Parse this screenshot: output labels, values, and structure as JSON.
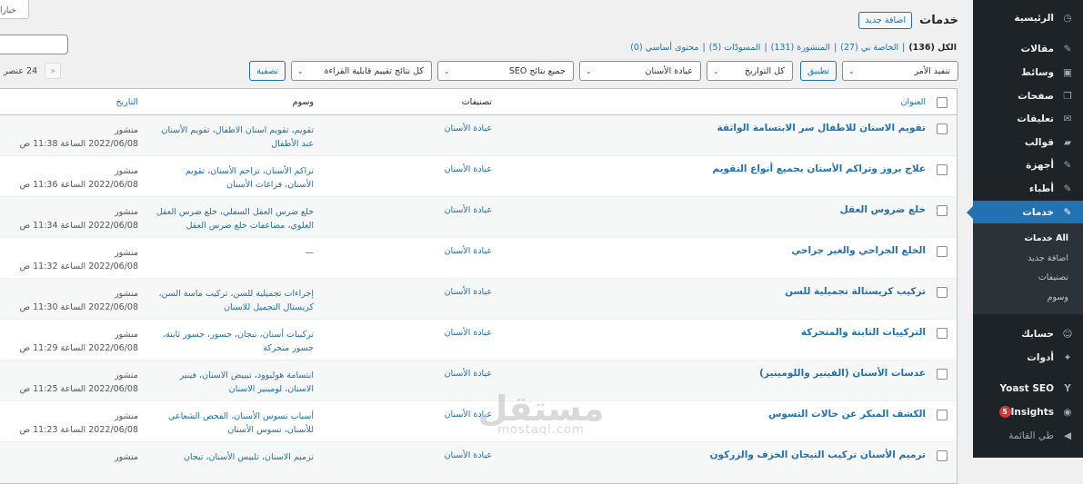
{
  "sidebar": {
    "items": [
      {
        "label": "الرئيسية",
        "icon": "dashboard-icon",
        "glyph": "◷"
      },
      {
        "label": "مقالات",
        "icon": "pin-icon",
        "glyph": "✎"
      },
      {
        "label": "وسائط",
        "icon": "media-icon",
        "glyph": "▣"
      },
      {
        "label": "صفحات",
        "icon": "pages-icon",
        "glyph": "❐"
      },
      {
        "label": "تعليقات",
        "icon": "comments-icon",
        "glyph": "✉"
      },
      {
        "label": "قوالب",
        "icon": "folder-icon",
        "glyph": "▰"
      },
      {
        "label": "أجهزة",
        "icon": "pin-icon",
        "glyph": "✎"
      },
      {
        "label": "أطباء",
        "icon": "pin-icon",
        "glyph": "✎"
      },
      {
        "label": "خدمات",
        "icon": "pin-icon",
        "glyph": "✎"
      }
    ],
    "submenu": [
      "All خدمات",
      "اضافة جديد",
      "تصنيفات",
      "وسوم"
    ],
    "items2": [
      {
        "label": "حسابك",
        "icon": "users-icon",
        "glyph": "👤"
      },
      {
        "label": "أدوات",
        "icon": "tools-icon",
        "glyph": "🔧"
      }
    ],
    "yoast": "Yoast SEO",
    "insights": "Insights",
    "insights_badge": "5",
    "collapse": "طي القائمة"
  },
  "header": {
    "screen_options": "خيارا",
    "title": "خدمات",
    "add_new": "اضافة جديد"
  },
  "views": {
    "all": "الكل (136)",
    "mine": "الخاصة بي (27)",
    "published": "المنشورة (131)",
    "drafts": "المسودّات (5)",
    "cornerstone": "محتوى أساسي (0)",
    "sep": "|"
  },
  "filters": {
    "bulk": "تنفيذ الأمر",
    "apply": "تطبيق",
    "dates": "كل التواريخ",
    "category": "عيادة الأسنان",
    "seo": "جميع نتائج SEO",
    "readability": "كل نتائج تقييم قابلية القراءة",
    "filter_btn": "تصفية",
    "count": "24 عنصر",
    "first_page": "«"
  },
  "table": {
    "headers": {
      "title": "العنوان",
      "categories": "تصنيفات",
      "tags": "وسوم",
      "date": "التاريخ"
    },
    "rows": [
      {
        "title": "تقويم الاسنان للاطفال سر الابتسامة الواثقة",
        "cat": "عيادة الأسنان",
        "tags": "تقويم، تقويم اسنان الاطفال، تقويم الأسنان عند الأطفال",
        "status": "منشور",
        "date": "2022/06/08 الساعة 11:38 ص"
      },
      {
        "title": "علاج بروز وتراكم الأسنان بجميع أنواع التقويم",
        "cat": "عيادة الأسنان",
        "tags": "تراكم الأسنان، تزاحم الأسنان، تقويم الأسنان، فراغات الأسنان",
        "status": "منشور",
        "date": "2022/06/08 الساعة 11:36 ص"
      },
      {
        "title": "خلع ضروس العقل",
        "cat": "عيادة الأسنان",
        "tags": "خلع ضرس العقل السفلي، خلع ضرس العقل العلوي، مضاعفات خلع ضرس العقل",
        "status": "منشور",
        "date": "2022/06/08 الساعة 11:34 ص"
      },
      {
        "title": "الخلع الجراحي والغير جراحي",
        "cat": "عيادة الأسنان",
        "tags": "—",
        "status": "منشور",
        "date": "2022/06/08 الساعة 11:32 ص"
      },
      {
        "title": "تركيب كريستالة تجميلية للسن",
        "cat": "عيادة الأسنان",
        "tags": "إجراءات تجميلية للسن، تركيب ماسة السن، كريستال التجميل للاسنان",
        "status": "منشور",
        "date": "2022/06/08 الساعة 11:30 ص"
      },
      {
        "title": "التركيبات الثابتة والمتحركة",
        "cat": "عيادة الأسنان",
        "tags": "تركيبات أسنان، تيجان، جسور، جسور ثابتة، جسور متحركة",
        "status": "منشور",
        "date": "2022/06/08 الساعة 11:29 ص"
      },
      {
        "title": "عدسات الأسنان (الفينير واللومينير)",
        "cat": "عيادة الأسنان",
        "tags": "ابتسامة هوليوود، تبييض الاسنان، فينير الاسنان، لومينير الاسنان",
        "status": "منشور",
        "date": "2022/06/08 الساعة 11:25 ص"
      },
      {
        "title": "الكشف المبكر عن حالات التسوس",
        "cat": "عيادة الأسنان",
        "tags": "أسباب تسوس الأسنان، الفحص الشعاعي للأسنان، تسوس الأسنان",
        "status": "منشور",
        "date": "2022/06/08 الساعة 11:23 ص"
      },
      {
        "title": "ترميم الأسنان تركيب التيجان الخزف والزركون",
        "cat": "عيادة الأسنان",
        "tags": "ترميم الاسنان، تلبيس الأسنان، تيجان",
        "status": "منشور",
        "date": ""
      }
    ]
  },
  "watermark": {
    "arabic": "مستقل",
    "latin": "mostaql.com"
  }
}
